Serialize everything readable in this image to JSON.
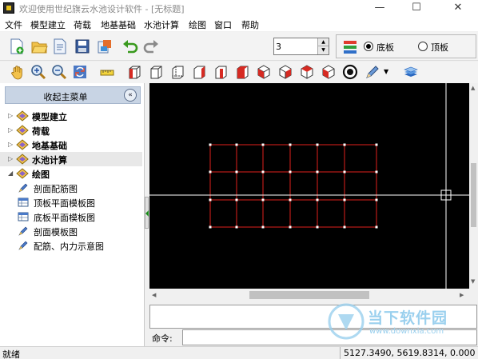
{
  "window": {
    "title": "欢迎使用世纪旗云水池设计软件 - [无标题]",
    "controls": {
      "minimize": "—",
      "maximize": "☐",
      "close": "✕"
    }
  },
  "menu": [
    "文件",
    "模型建立",
    "荷载",
    "地基基础",
    "水池计算",
    "绘图",
    "窗口",
    "帮助"
  ],
  "toolbar": {
    "layer_value": "3",
    "radio_bottom": "底板",
    "radio_top": "顶板",
    "selected_radio": "底板"
  },
  "left_panel": {
    "header": "收起主菜单",
    "collapse_glyph": "«",
    "items": [
      {
        "label": "模型建立",
        "expanded": false
      },
      {
        "label": "荷载",
        "expanded": false
      },
      {
        "label": "地基基础",
        "expanded": false
      },
      {
        "label": "水池计算",
        "expanded": false,
        "selected": true
      },
      {
        "label": "绘图",
        "expanded": true
      }
    ],
    "sub_items": [
      "剖面配筋图",
      "顶板平面模板图",
      "底板平面模板图",
      "剖面模板图",
      "配筋、内力示意图"
    ]
  },
  "command": {
    "label": "命令:"
  },
  "status": {
    "text": "就绪",
    "coordinates": "5127.3490,   5619.8314,   0.000"
  },
  "watermark": {
    "title": "当下软件园",
    "url": "www.downxia.com"
  },
  "colors": {
    "canvas": "#000000",
    "grid": "#e0201c",
    "node": "#ffffff",
    "crosshair": "#ffffff",
    "panel_header": "#c8d4e4"
  }
}
